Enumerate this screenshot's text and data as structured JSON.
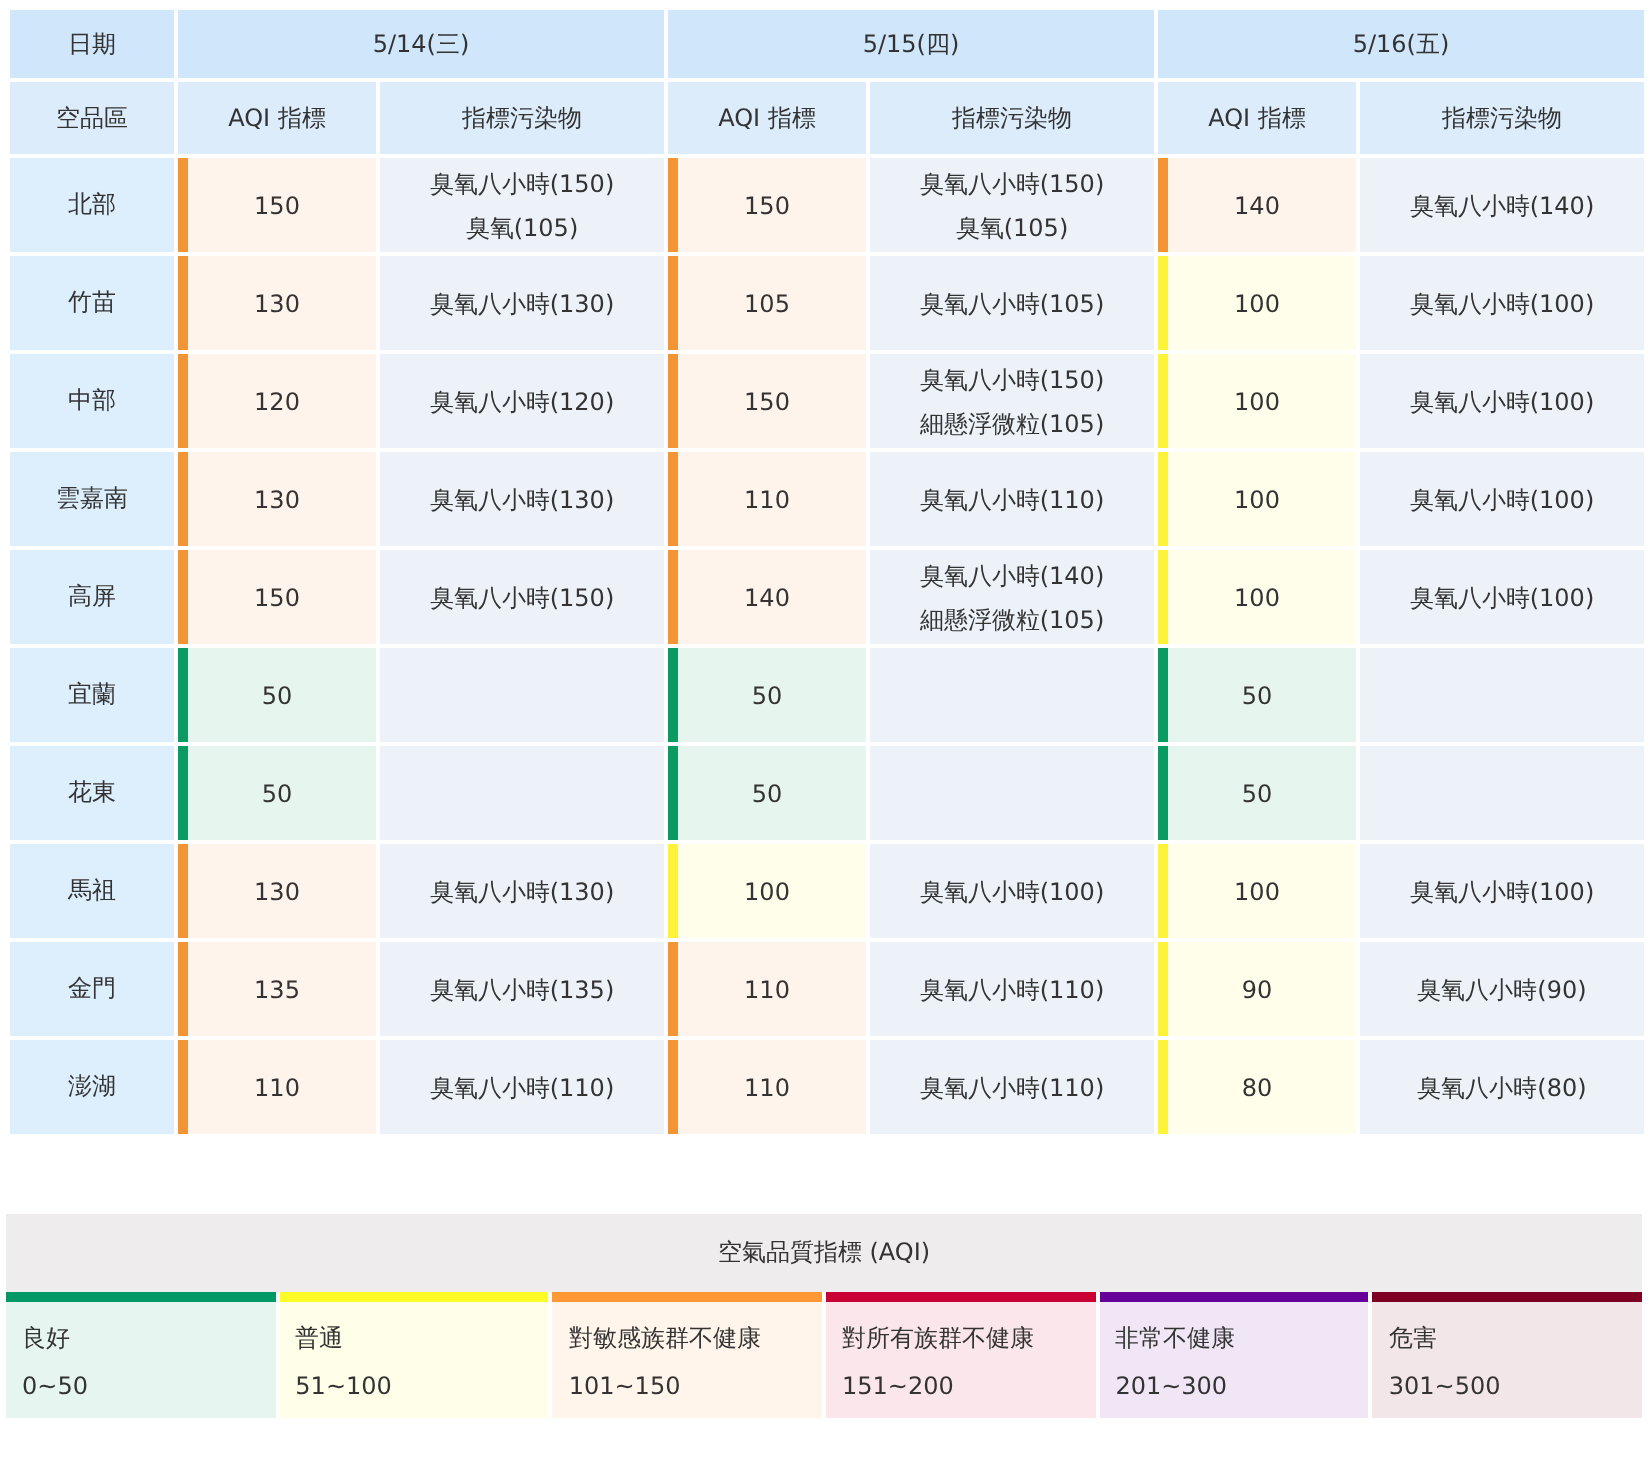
{
  "table": {
    "date_label": "日期",
    "region_label": "空品區",
    "dates": [
      {
        "date": "5/14(三)",
        "subheaders": [
          "AQI 指標",
          "指標污染物"
        ]
      },
      {
        "date": "5/15(四)",
        "subheaders": [
          "AQI 指標",
          "指標污染物"
        ]
      },
      {
        "date": "5/16(五)",
        "subheaders": [
          "AQI 指標",
          "指標污染物"
        ]
      }
    ],
    "rows": [
      {
        "region": "北部",
        "days": [
          {
            "aqi": "150",
            "color": "#f39536",
            "pollutants": [
              "臭氧八小時(150)",
              "臭氧(105)"
            ]
          },
          {
            "aqi": "150",
            "color": "#f39536",
            "pollutants": [
              "臭氧八小時(150)",
              "臭氧(105)"
            ]
          },
          {
            "aqi": "140",
            "color": "#f39536",
            "pollutants": [
              "臭氧八小時(140)"
            ]
          }
        ]
      },
      {
        "region": "竹苗",
        "days": [
          {
            "aqi": "130",
            "color": "#f39536",
            "pollutants": [
              "臭氧八小時(130)"
            ]
          },
          {
            "aqi": "105",
            "color": "#f39536",
            "pollutants": [
              "臭氧八小時(105)"
            ]
          },
          {
            "aqi": "100",
            "color": "#fff23a",
            "pollutants": [
              "臭氧八小時(100)"
            ]
          }
        ]
      },
      {
        "region": "中部",
        "days": [
          {
            "aqi": "120",
            "color": "#f39536",
            "pollutants": [
              "臭氧八小時(120)"
            ]
          },
          {
            "aqi": "150",
            "color": "#f39536",
            "pollutants": [
              "臭氧八小時(150)",
              "細懸浮微粒(105)"
            ]
          },
          {
            "aqi": "100",
            "color": "#fff23a",
            "pollutants": [
              "臭氧八小時(100)"
            ]
          }
        ]
      },
      {
        "region": "雲嘉南",
        "days": [
          {
            "aqi": "130",
            "color": "#f39536",
            "pollutants": [
              "臭氧八小時(130)"
            ]
          },
          {
            "aqi": "110",
            "color": "#f39536",
            "pollutants": [
              "臭氧八小時(110)"
            ]
          },
          {
            "aqi": "100",
            "color": "#fff23a",
            "pollutants": [
              "臭氧八小時(100)"
            ]
          }
        ]
      },
      {
        "region": "高屏",
        "days": [
          {
            "aqi": "150",
            "color": "#f39536",
            "pollutants": [
              "臭氧八小時(150)"
            ]
          },
          {
            "aqi": "140",
            "color": "#f39536",
            "pollutants": [
              "臭氧八小時(140)",
              "細懸浮微粒(105)"
            ]
          },
          {
            "aqi": "100",
            "color": "#fff23a",
            "pollutants": [
              "臭氧八小時(100)"
            ]
          }
        ]
      },
      {
        "region": "宜蘭",
        "days": [
          {
            "aqi": "50",
            "color": "#0b9a62"
          },
          {
            "aqi": "50",
            "color": "#0b9a62"
          },
          {
            "aqi": "50",
            "color": "#0b9a62"
          }
        ]
      },
      {
        "region": "花東",
        "days": [
          {
            "aqi": "50",
            "color": "#0b9a62"
          },
          {
            "aqi": "50",
            "color": "#0b9a62"
          },
          {
            "aqi": "50",
            "color": "#0b9a62"
          }
        ]
      },
      {
        "region": "馬祖",
        "days": [
          {
            "aqi": "130",
            "color": "#f39536",
            "pollutants": [
              "臭氧八小時(130)"
            ]
          },
          {
            "aqi": "100",
            "color": "#fff23a",
            "pollutants": [
              "臭氧八小時(100)"
            ]
          },
          {
            "aqi": "100",
            "color": "#fff23a",
            "pollutants": [
              "臭氧八小時(100)"
            ]
          }
        ]
      },
      {
        "region": "金門",
        "days": [
          {
            "aqi": "135",
            "color": "#f39536",
            "pollutants": [
              "臭氧八小時(135)"
            ]
          },
          {
            "aqi": "110",
            "color": "#f39536",
            "pollutants": [
              "臭氧八小時(110)"
            ]
          },
          {
            "aqi": "90",
            "color": "#fff23a",
            "pollutants": [
              "臭氧八小時(90)"
            ]
          }
        ]
      },
      {
        "region": "澎湖",
        "days": [
          {
            "aqi": "110",
            "color": "#f39536",
            "pollutants": [
              "臭氧八小時(110)"
            ]
          },
          {
            "aqi": "110",
            "color": "#f39536",
            "pollutants": [
              "臭氧八小時(110)"
            ]
          },
          {
            "aqi": "80",
            "color": "#fff23a",
            "pollutants": [
              "臭氧八小時(80)"
            ]
          }
        ]
      }
    ]
  },
  "legend": {
    "title": "空氣品質指標 (AQI)",
    "items": [
      {
        "label": "良好",
        "range": "0~50",
        "color": "#009865"
      },
      {
        "label": "普通",
        "range": "51~100",
        "color": "#fffb26"
      },
      {
        "label": "對敏感族群不健康",
        "range": "101~150",
        "color": "#ff9835"
      },
      {
        "label": "對所有族群不健康",
        "range": "151~200",
        "color": "#ca0034"
      },
      {
        "label": "非常不健康",
        "range": "201~300",
        "color": "#670099"
      },
      {
        "label": "危害",
        "range": "301~500",
        "color": "#7e0023"
      }
    ]
  }
}
